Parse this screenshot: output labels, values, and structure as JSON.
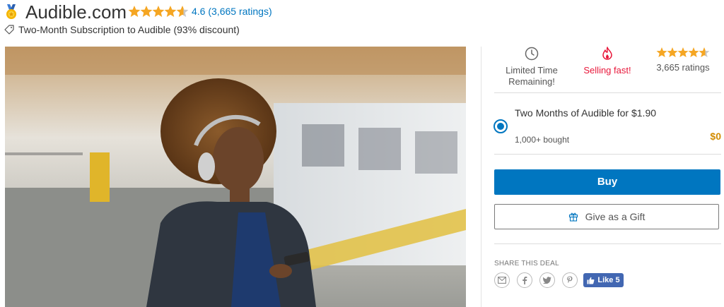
{
  "header": {
    "title": "Audible.com",
    "rating_value": 4.6,
    "rating_text": "4.6 (3,665 ratings)",
    "subtitle": "Two-Month Subscription to Audible (93% discount)"
  },
  "highlights": {
    "time": {
      "icon": "clock-icon",
      "label_line1": "Limited Time",
      "label_line2": "Remaining!"
    },
    "selling": {
      "icon": "flame-icon",
      "label": "Selling fast!"
    },
    "ratings": {
      "icon": "stars-icon",
      "label": "3,665 ratings"
    }
  },
  "option": {
    "title": "Two Months of Audible for $1.90",
    "bought": "1,000+ bought",
    "price": "$0",
    "selected": true
  },
  "buttons": {
    "buy_label": "Buy",
    "gift_label": "Give as a Gift"
  },
  "share": {
    "label": "SHARE THIS DEAL",
    "icons": [
      "email-icon",
      "facebook-icon",
      "twitter-icon",
      "pinterest-icon"
    ],
    "fb_like_label": "Like 5"
  },
  "colors": {
    "star": "#f5a623",
    "link": "#0076c0",
    "accent": "#0076c0",
    "selling": "#e8173a",
    "price": "#d28b00"
  }
}
